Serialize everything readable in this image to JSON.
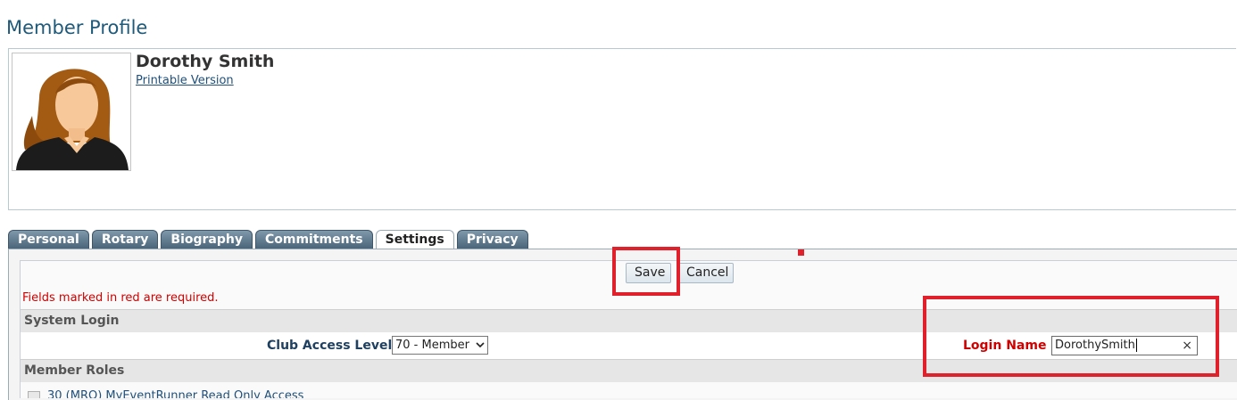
{
  "page": {
    "title": "Member Profile"
  },
  "member": {
    "name": "Dorothy Smith",
    "printable_link": "Printable Version"
  },
  "tabs": [
    {
      "label": "Personal"
    },
    {
      "label": "Rotary"
    },
    {
      "label": "Biography"
    },
    {
      "label": "Commitments"
    },
    {
      "label": "Settings",
      "active": true
    },
    {
      "label": "Privacy"
    }
  ],
  "actions": {
    "save_label": "Save",
    "cancel_label": "Cancel"
  },
  "notes": {
    "required": "Fields marked in red are required."
  },
  "system_login": {
    "header": "System Login",
    "club_access_label": "Club Access Level",
    "club_access_value": "70 - Member",
    "login_name_label": "Login Name",
    "login_name_value": "DorothySmith"
  },
  "member_roles": {
    "header": "Member Roles",
    "items": [
      {
        "label": "30 (MRO) MyEventRunner Read Only Access"
      }
    ]
  },
  "colors": {
    "highlight": "#e0202a",
    "title": "#1f5a7a",
    "required": "#d00000"
  }
}
